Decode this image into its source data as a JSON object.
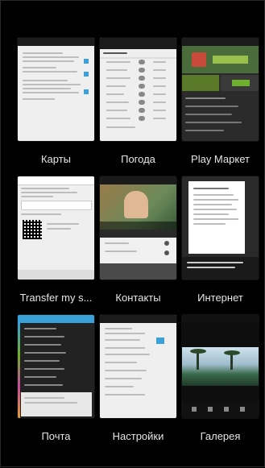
{
  "apps": [
    {
      "label": "Карты"
    },
    {
      "label": "Погода"
    },
    {
      "label": "Play Маркет"
    },
    {
      "label": "Transfer my s..."
    },
    {
      "label": "Контакты"
    },
    {
      "label": "Интернет"
    },
    {
      "label": "Почта"
    },
    {
      "label": "Настройки"
    },
    {
      "label": "Галерея"
    }
  ],
  "colors": {
    "background": "#000000",
    "label": "#e6e6e6",
    "accent_blue": "#3aa0d8",
    "accent_green": "#6fb02c"
  }
}
